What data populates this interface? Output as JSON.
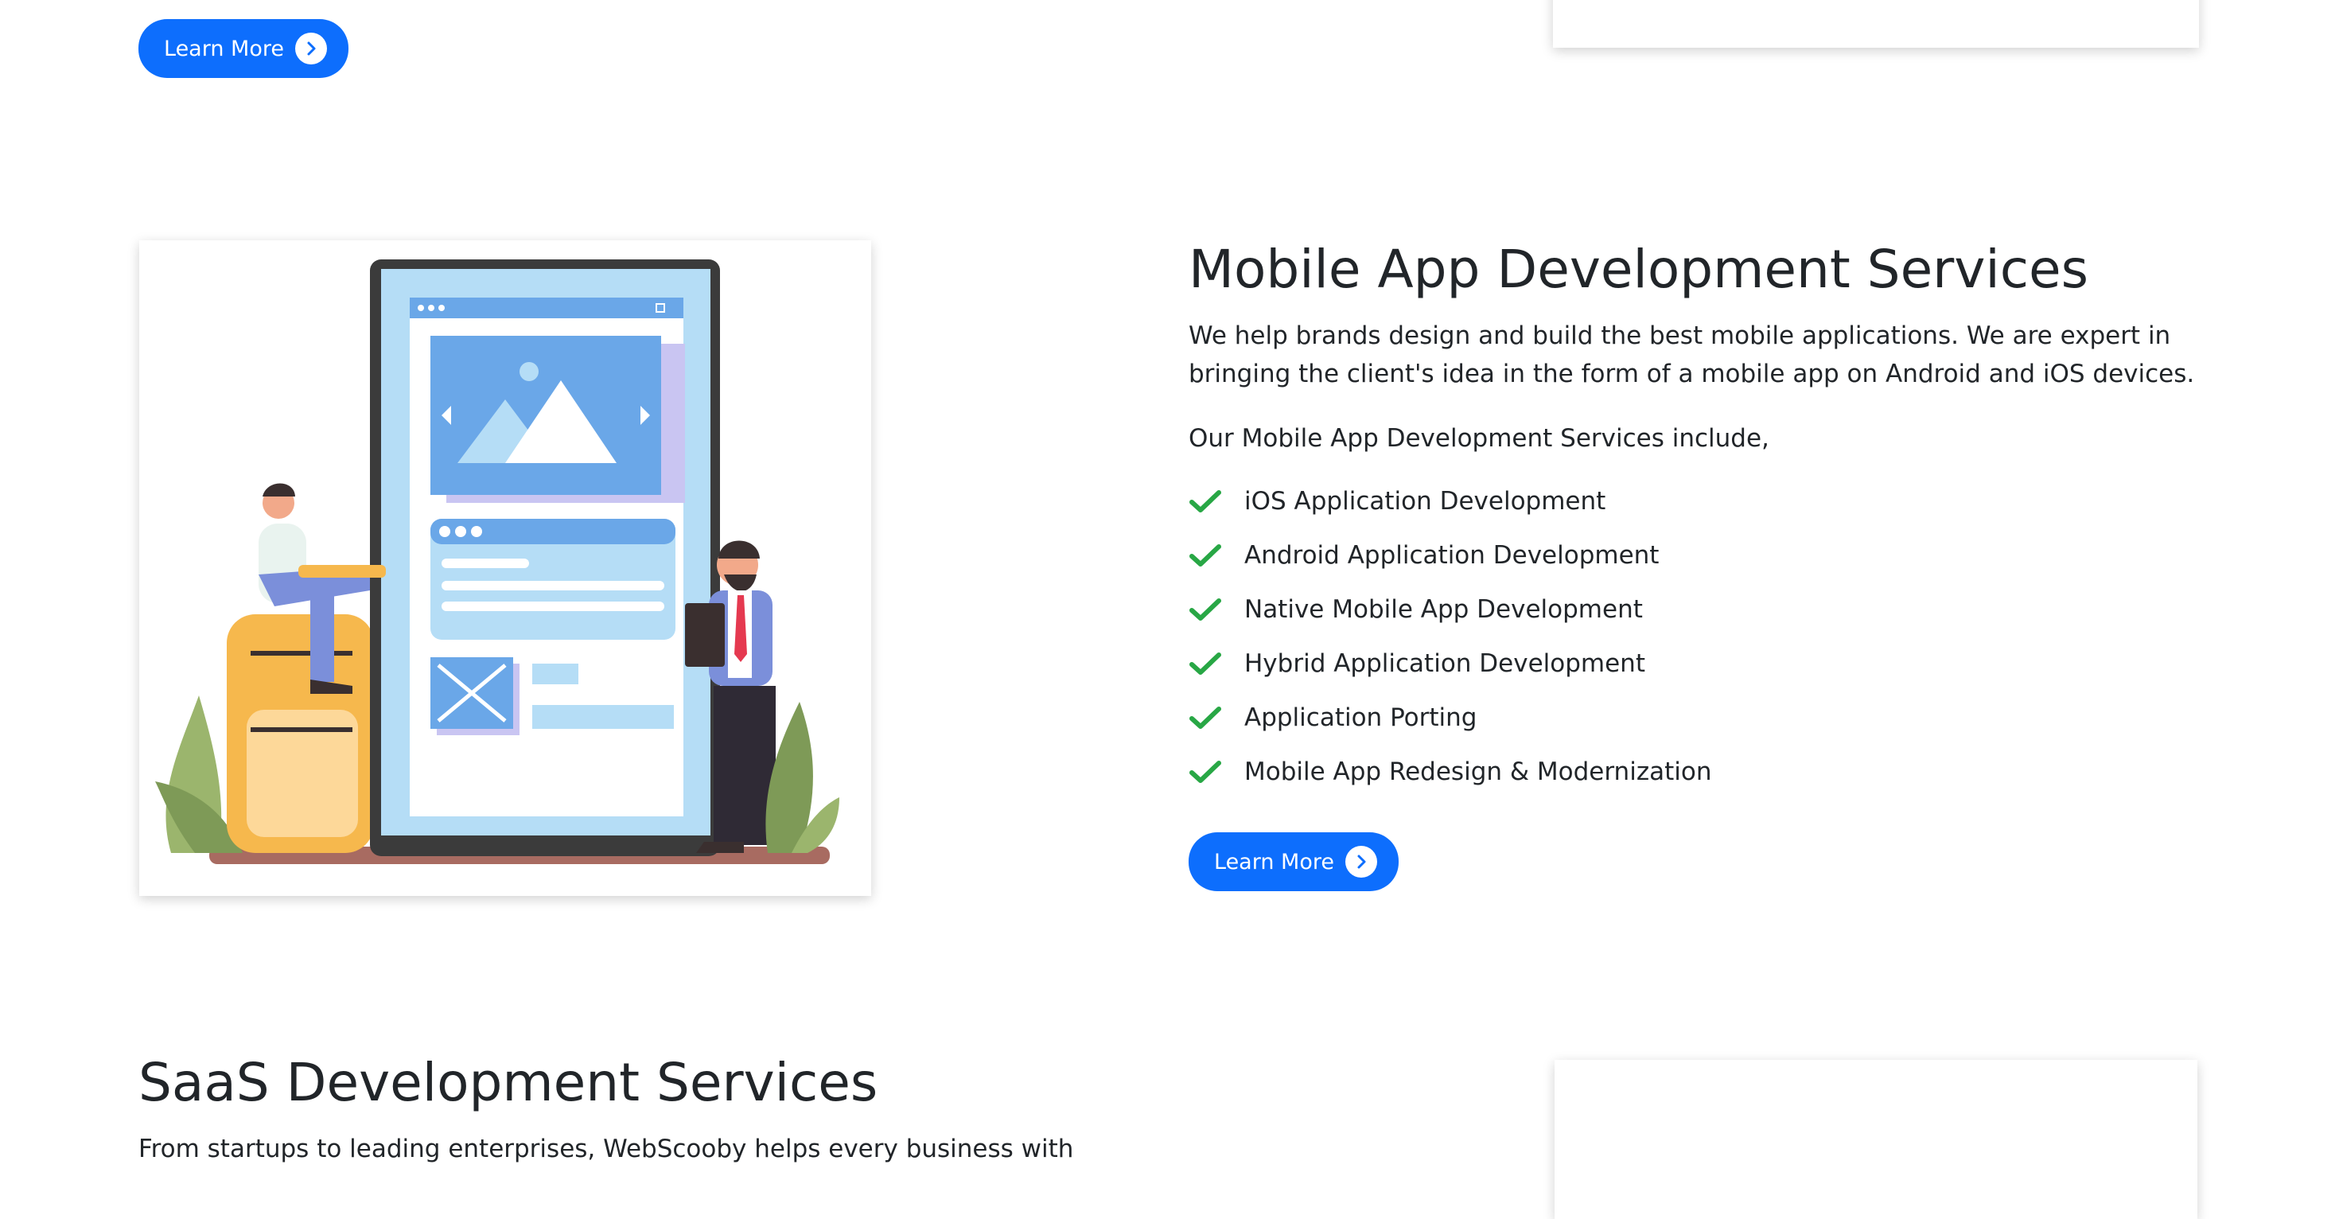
{
  "top_section": {
    "learn_more_label": "Learn More"
  },
  "mobile_section": {
    "title": "Mobile App Development Services",
    "description": "We help brands design and build the best mobile applications. We are expert in bringing the client's idea in the form of a mobile app on Android and iOS devices.",
    "intro": "Our Mobile App Development Services include,",
    "services": [
      "iOS Application Development",
      "Android Application Development",
      "Native Mobile App Development",
      "Hybrid Application Development",
      "Application Porting",
      "Mobile App Redesign & Modernization"
    ],
    "learn_more_label": "Learn More"
  },
  "saas_section": {
    "title": "SaaS Development Services",
    "description": "From startups to leading enterprises, WebScooby helps every business with"
  },
  "colors": {
    "primary": "#0d6efd",
    "check_green": "#28a745",
    "text": "#212529"
  },
  "icons": {
    "button_icon": "chevron-right-circle-icon",
    "list_icon": "check-icon"
  }
}
